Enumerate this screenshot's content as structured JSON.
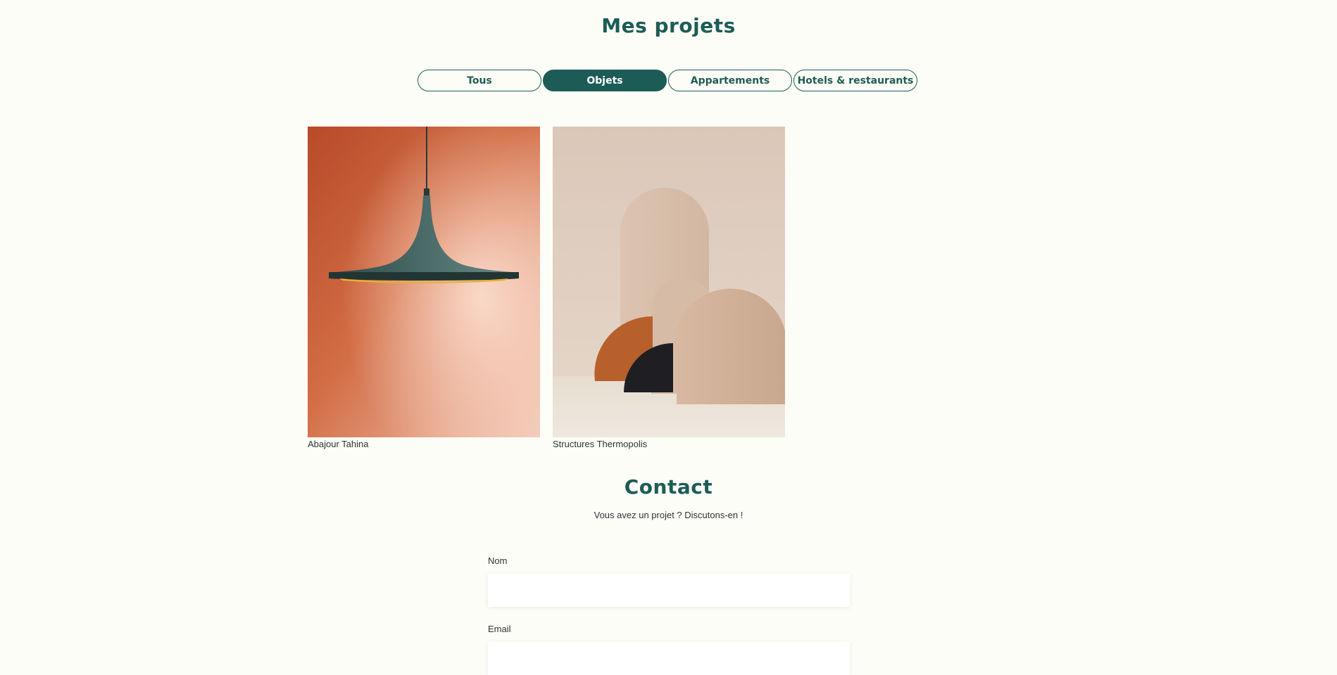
{
  "projects": {
    "title": "Mes projets",
    "filters": [
      {
        "label": "Tous",
        "active": false
      },
      {
        "label": "Objets",
        "active": true
      },
      {
        "label": "Appartements",
        "active": false
      },
      {
        "label": "Hotels & restaurants",
        "active": false
      }
    ],
    "items": [
      {
        "caption": "Abajour Tahina"
      },
      {
        "caption": "Structures Thermopolis"
      }
    ]
  },
  "contact": {
    "title": "Contact",
    "subtitle": "Vous avez un projet ? Discutons-en !",
    "fields": [
      {
        "label": "Nom",
        "value": ""
      },
      {
        "label": "Email",
        "value": ""
      }
    ]
  },
  "colors": {
    "background": "#fdfdf7",
    "accent": "#1d5c56",
    "text": "#2c3433"
  }
}
